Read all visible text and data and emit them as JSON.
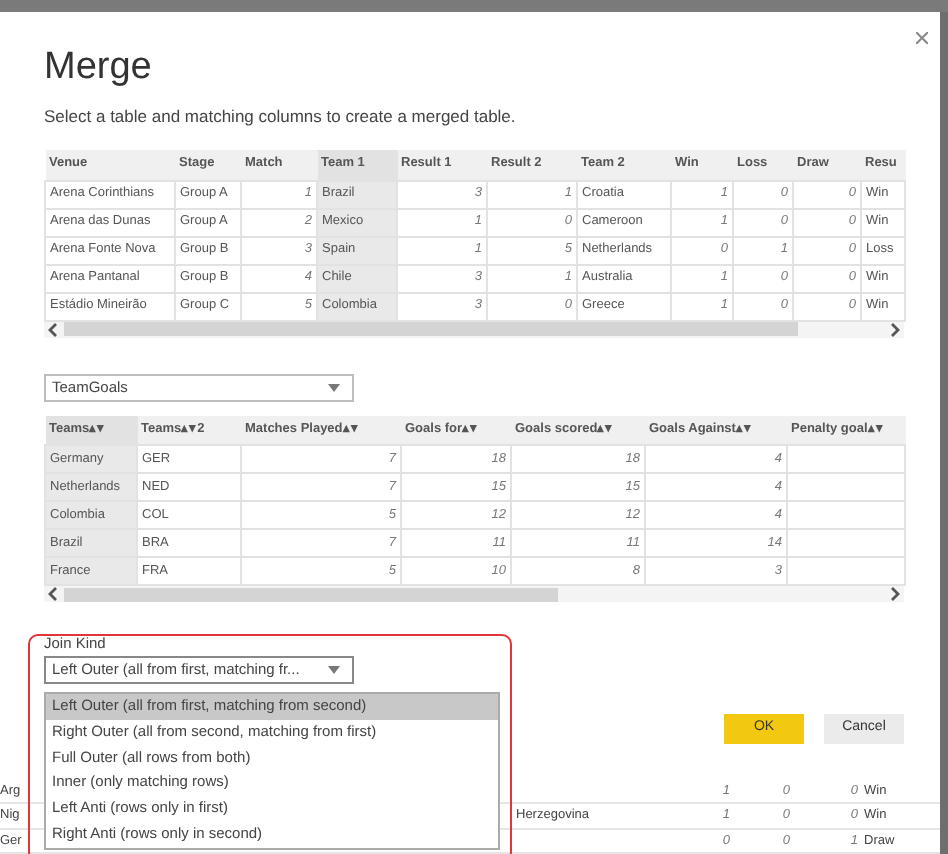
{
  "dialog": {
    "title": "Merge",
    "instruction": "Select a table and matching columns to create a merged table.",
    "first_table": {
      "columns": [
        {
          "label": "Venue",
          "kind": "text",
          "selected": false
        },
        {
          "label": "Stage",
          "kind": "text",
          "selected": false
        },
        {
          "label": "Match",
          "kind": "number",
          "selected": false
        },
        {
          "label": "Team 1",
          "kind": "text",
          "selected": true
        },
        {
          "label": "Result 1",
          "kind": "number",
          "selected": false
        },
        {
          "label": "Result 2",
          "kind": "number",
          "selected": false
        },
        {
          "label": "Team 2",
          "kind": "text",
          "selected": false
        },
        {
          "label": "Win",
          "kind": "number",
          "selected": false
        },
        {
          "label": "Loss",
          "kind": "number",
          "selected": false
        },
        {
          "label": "Draw",
          "kind": "number",
          "selected": false
        },
        {
          "label": "Resu",
          "kind": "text",
          "selected": false
        }
      ],
      "rows": [
        [
          "Arena Corinthians",
          "Group A",
          "1",
          "Brazil",
          "3",
          "1",
          "Croatia",
          "1",
          "0",
          "0",
          "Win"
        ],
        [
          "Arena das Dunas",
          "Group A",
          "2",
          "Mexico",
          "1",
          "0",
          "Cameroon",
          "1",
          "0",
          "0",
          "Win"
        ],
        [
          "Arena Fonte Nova",
          "Group B",
          "3",
          "Spain",
          "1",
          "5",
          "Netherlands",
          "0",
          "1",
          "0",
          "Loss"
        ],
        [
          "Arena Pantanal",
          "Group B",
          "4",
          "Chile",
          "3",
          "1",
          "Australia",
          "1",
          "0",
          "0",
          "Win"
        ],
        [
          "Estádio Mineirão",
          "Group C",
          "5",
          "Colombia",
          "3",
          "0",
          "Greece",
          "1",
          "0",
          "0",
          "Win"
        ]
      ]
    },
    "second_table_select": {
      "value": "TeamGoals"
    },
    "second_table": {
      "columns": [
        {
          "label": "Teams▴▾",
          "kind": "text",
          "selected": true
        },
        {
          "label": "Teams▴▾2",
          "kind": "text",
          "selected": false
        },
        {
          "label": "Matches Played▴▾",
          "kind": "number",
          "selected": false
        },
        {
          "label": "Goals for▴▾",
          "kind": "number",
          "selected": false
        },
        {
          "label": "Goals scored▴▾",
          "kind": "number",
          "selected": false
        },
        {
          "label": "Goals Against▴▾",
          "kind": "number",
          "selected": false
        },
        {
          "label": "Penalty goal▴▾",
          "kind": "number",
          "selected": false
        }
      ],
      "rows": [
        [
          "Germany",
          "GER",
          "7",
          "18",
          "18",
          "4",
          ""
        ],
        [
          "Netherlands",
          "NED",
          "7",
          "15",
          "15",
          "4",
          ""
        ],
        [
          "Colombia",
          "COL",
          "5",
          "12",
          "12",
          "4",
          ""
        ],
        [
          "Brazil",
          "BRA",
          "7",
          "11",
          "11",
          "14",
          ""
        ],
        [
          "France",
          "FRA",
          "5",
          "10",
          "8",
          "3",
          ""
        ]
      ]
    },
    "join_kind": {
      "label": "Join Kind",
      "value": "Left Outer (all from first, matching fr...",
      "expanded": true,
      "options": [
        {
          "label": "Left Outer (all from first, matching from second)",
          "selected": true
        },
        {
          "label": "Right Outer (all from second, matching from first)",
          "selected": false
        },
        {
          "label": "Full Outer (all rows from both)",
          "selected": false
        },
        {
          "label": "Inner (only matching rows)",
          "selected": false
        },
        {
          "label": "Left Anti (rows only in first)",
          "selected": false
        },
        {
          "label": "Right Anti (rows only in second)",
          "selected": false
        }
      ]
    },
    "buttons": [
      {
        "label": "OK",
        "kind": "primary"
      },
      {
        "label": "Cancel",
        "kind": "secondary"
      }
    ]
  },
  "background_table": {
    "rows": [
      [
        "Arg",
        "",
        "1",
        "0",
        "0",
        "Win"
      ],
      [
        "Nig",
        "Herzegovina",
        "1",
        "0",
        "0",
        "Win"
      ],
      [
        "Ger",
        "",
        "0",
        "0",
        "1",
        "Draw"
      ]
    ]
  }
}
